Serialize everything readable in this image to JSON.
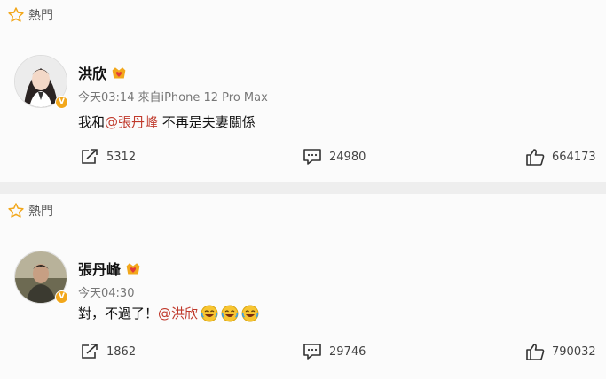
{
  "posts": [
    {
      "hot_label": "熱門",
      "user_name": "洪欣",
      "time": "今天03:14",
      "source": "來自iPhone 12 Pro Max",
      "text_before": "我和",
      "mention": "@張丹峰",
      "text_after": " 不再是夫妻關係",
      "repost_count": "5312",
      "comment_count": "24980",
      "like_count": "664173"
    },
    {
      "hot_label": "熱門",
      "user_name": "張丹峰",
      "time": "今天04:30",
      "text_before": "對，不過了！",
      "mention": "@洪欣",
      "repost_count": "1862",
      "comment_count": "29746",
      "like_count": "790032"
    }
  ],
  "colors": {
    "mention": "#c0392b",
    "badge": "#f2a71b",
    "hot_star": "#f2a71b"
  },
  "icons": [
    "star-outline-icon",
    "verified-badge-icon",
    "crown-heart-icon",
    "repost-icon",
    "comment-icon",
    "like-icon",
    "laughing-crying-emoji-icon"
  ]
}
